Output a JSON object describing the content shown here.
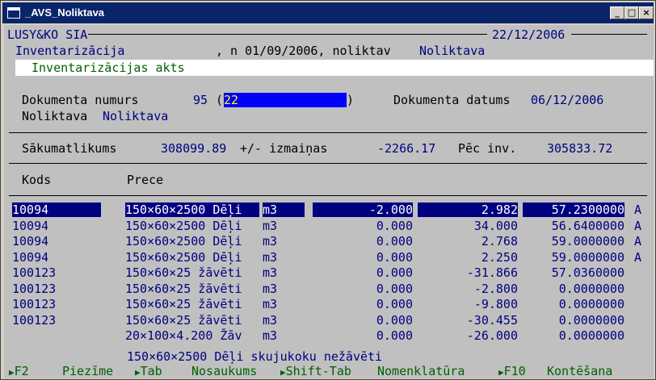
{
  "window": {
    "title": "_AVS_Noliktava"
  },
  "header": {
    "company": "LUSY&KO SIA",
    "date": "22/12/2006",
    "module": "Inventarizācija",
    "period": ", n 01/09/2006, noliktav",
    "warehouse": "Noliktava",
    "subtitle": "Inventarizācijas akts"
  },
  "doc": {
    "number_label": "Dokumenta numurs",
    "number": "95",
    "paren_open": "(",
    "input_value": "22",
    "paren_close": ")",
    "date_label": "Dokumenta datums",
    "date": "06/12/2006",
    "warehouse_label": "Noliktava",
    "warehouse": "Noliktava"
  },
  "balance": {
    "start_label": "Sākumatlikums",
    "start_value": "308099.89",
    "change_label": "+/- izmaiņas",
    "change_value": "-2266.17",
    "after_label": "Pēc inv.",
    "after_value": "305833.72"
  },
  "table": {
    "col_code": "Kods",
    "col_item": "Prece",
    "rows": [
      {
        "code": "10094",
        "item": "150×60×2500 Dēļi",
        "unit": "m3",
        "diff": "-2.000",
        "qty": "2.982",
        "price": "57.2300000",
        "flag": "A"
      },
      {
        "code": "10094",
        "item": "150×60×2500 Dēļi",
        "unit": "m3",
        "diff": "0.000",
        "qty": "34.000",
        "price": "56.6400000",
        "flag": "A"
      },
      {
        "code": "10094",
        "item": "150×60×2500 Dēļi",
        "unit": "m3",
        "diff": "0.000",
        "qty": "2.768",
        "price": "59.0000000",
        "flag": "A"
      },
      {
        "code": "10094",
        "item": "150×60×2500 Dēļi",
        "unit": "m3",
        "diff": "0.000",
        "qty": "2.250",
        "price": "59.0000000",
        "flag": "A"
      },
      {
        "code": "100123",
        "item": "150×60×25 žāvēti",
        "unit": "m3",
        "diff": "0.000",
        "qty": "-31.866",
        "price": "57.0360000",
        "flag": ""
      },
      {
        "code": "100123",
        "item": "150×60×25 žāvēti",
        "unit": "m3",
        "diff": "0.000",
        "qty": "-2.800",
        "price": "0.0000000",
        "flag": ""
      },
      {
        "code": "100123",
        "item": "150×60×25 žāvēti",
        "unit": "m3",
        "diff": "0.000",
        "qty": "-9.800",
        "price": "0.0000000",
        "flag": ""
      },
      {
        "code": "100123",
        "item": "150×60×25 žāvēti",
        "unit": "m3",
        "diff": "0.000",
        "qty": "-30.455",
        "price": "0.0000000",
        "flag": ""
      },
      {
        "code": "",
        "item": "20×100×4.200 Žāv",
        "unit": "m3",
        "diff": "0.000",
        "qty": "-26.000",
        "price": "0.0000000",
        "flag": ""
      }
    ],
    "footer_desc": "150×60×2500 Dēļi skujukoku nežāvēti"
  },
  "fkeys": [
    {
      "key": "F2",
      "label": "Piezīme"
    },
    {
      "key": "Tab",
      "label": "Nosaukums"
    },
    {
      "key": "Shift-Tab",
      "label": "Nomenklatūra"
    },
    {
      "key": "F10",
      "label": "Kontēšana"
    }
  ]
}
